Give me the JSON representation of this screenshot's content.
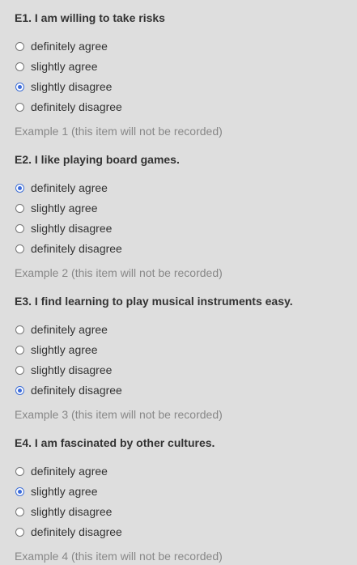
{
  "questions": [
    {
      "title": "E1. I am willing to take risks",
      "options": [
        "definitely agree",
        "slightly agree",
        "slightly disagree",
        "definitely disagree"
      ],
      "selected": 2,
      "note": "Example 1 (this item will not be recorded)"
    },
    {
      "title": "E2. I like playing board games.",
      "options": [
        "definitely agree",
        "slightly agree",
        "slightly disagree",
        "definitely disagree"
      ],
      "selected": 0,
      "note": "Example 2 (this item will not be recorded)"
    },
    {
      "title": "E3. I find learning to play musical instruments easy.",
      "options": [
        "definitely agree",
        "slightly agree",
        "slightly disagree",
        "definitely disagree"
      ],
      "selected": 3,
      "note": "Example 3 (this item will not be recorded)"
    },
    {
      "title": "E4. I am fascinated by other cultures.",
      "options": [
        "definitely agree",
        "slightly agree",
        "slightly disagree",
        "definitely disagree"
      ],
      "selected": 1,
      "note": "Example 4 (this item will not be recorded)"
    }
  ],
  "colors": {
    "background": "#dedede",
    "text": "#333333",
    "muted": "#888888",
    "accent": "#3b6bdc"
  }
}
